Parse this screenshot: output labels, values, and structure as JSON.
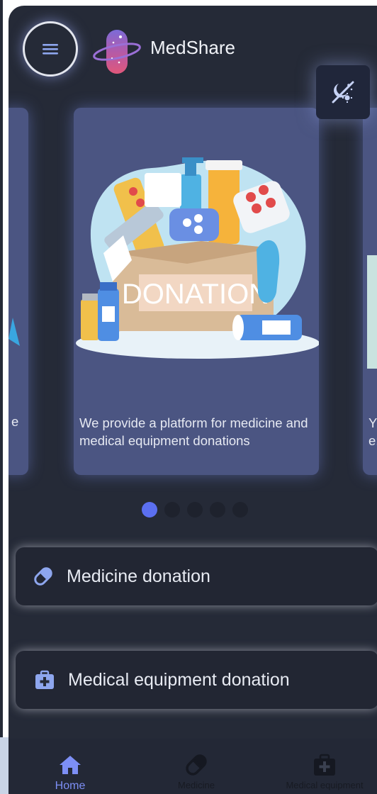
{
  "app": {
    "title": "MedShare"
  },
  "header": {
    "menu_icon": "hamburger-icon",
    "theme_icon": "theme-toggle-icon"
  },
  "carousel": {
    "slides": [
      {
        "caption_fragment": "e"
      },
      {
        "illustration_label": "DONATION",
        "caption": "We provide a platform for medicine and medical equipment donations"
      },
      {
        "caption_fragment": "Y\ne:"
      }
    ],
    "dot_count": 5,
    "active_index": 0
  },
  "options": [
    {
      "label": "Medicine donation",
      "icon": "pill-icon"
    },
    {
      "label": "Medical equipment donation",
      "icon": "medical-kit-icon"
    }
  ],
  "bottom_nav": {
    "items": [
      {
        "label": "Home",
        "icon": "home-icon",
        "active": true
      },
      {
        "label": "Medicine",
        "icon": "pill-icon",
        "active": false
      },
      {
        "label": "Medical equipment",
        "icon": "medical-kit-icon",
        "active": false
      }
    ]
  },
  "colors": {
    "background": "#252a37",
    "card": "#4b5582",
    "accent": "#5b6ff0",
    "icon_blue": "#8ea6ee",
    "nav_active": "#7d8ff5"
  }
}
